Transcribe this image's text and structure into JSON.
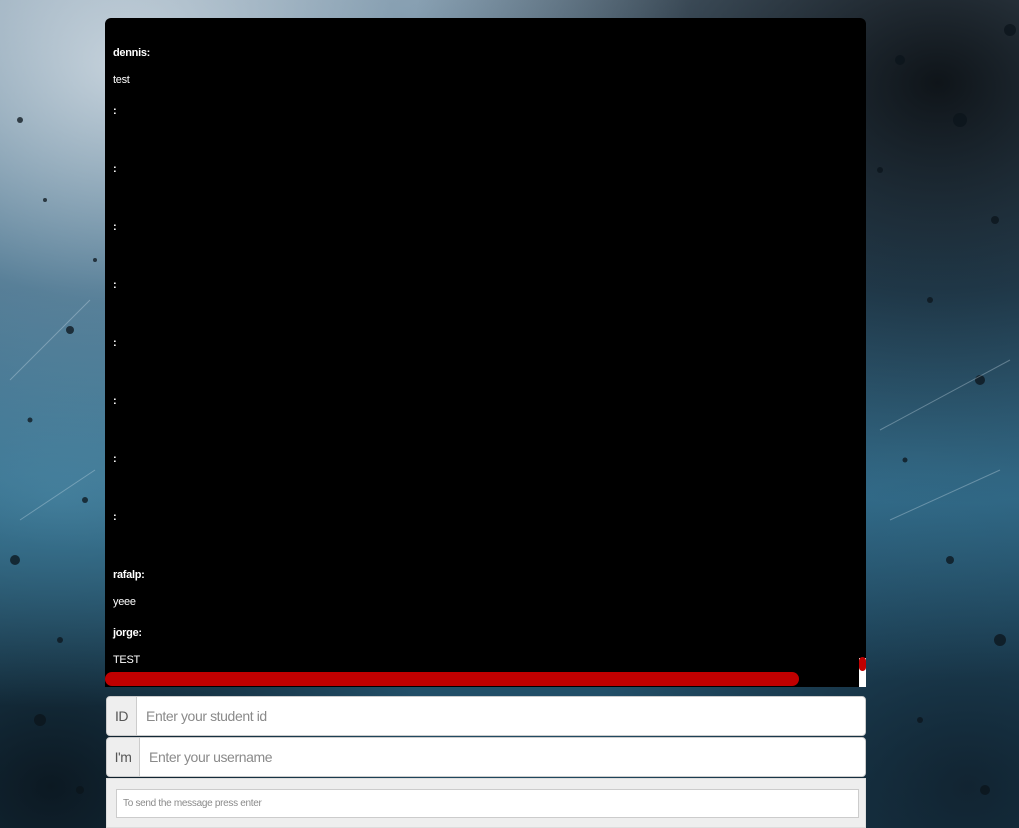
{
  "chat": {
    "messages": [
      {
        "user": "dennis:",
        "text": "test"
      },
      {
        "user": ":",
        "text": ""
      },
      {
        "user": ":",
        "text": ""
      },
      {
        "user": ":",
        "text": ""
      },
      {
        "user": ":",
        "text": ""
      },
      {
        "user": ":",
        "text": ""
      },
      {
        "user": ":",
        "text": ""
      },
      {
        "user": ":",
        "text": ""
      },
      {
        "user": ":",
        "text": ""
      },
      {
        "user": "rafalp:",
        "text": "yeee"
      },
      {
        "user": "jorge:",
        "text": "TEST"
      }
    ]
  },
  "form": {
    "id_label": "ID",
    "id_placeholder": "Enter your student id",
    "user_label": "I'm",
    "user_placeholder": "Enter your username",
    "message_placeholder": "To send the message press enter"
  },
  "colors": {
    "scrollbar": "#c00000",
    "panel": "#000000"
  }
}
